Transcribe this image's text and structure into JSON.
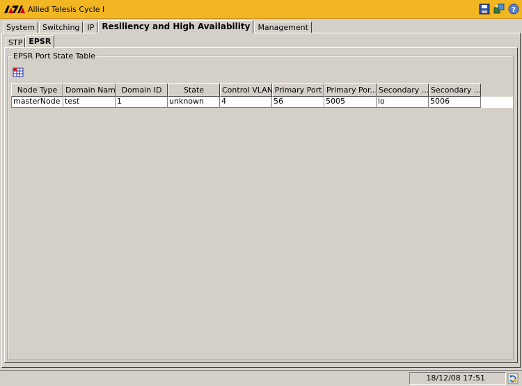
{
  "window": {
    "title": "Allied Telesis Cycle I",
    "logo_icon": "allied-telesis-logo",
    "icons": [
      "save-icon",
      "network-icon",
      "help-icon"
    ]
  },
  "tabs": [
    {
      "label": "System",
      "active": false
    },
    {
      "label": "Switching",
      "active": false
    },
    {
      "label": "IP",
      "active": false
    },
    {
      "label": "Resiliency and High Availability",
      "active": true
    },
    {
      "label": "Management",
      "active": false
    }
  ],
  "subtabs": [
    {
      "label": "STP",
      "active": false
    },
    {
      "label": "EPSR",
      "active": true
    }
  ],
  "panel": {
    "legend": "EPSR Port State Table",
    "table_icon": "table-icon"
  },
  "table": {
    "columns": [
      "Node Type",
      "Domain Name",
      "Domain ID",
      "State",
      "Control VLAN",
      "Primary Port",
      "Primary Por...",
      "Secondary ...",
      "Secondary ..."
    ],
    "rows": [
      [
        "masterNode",
        "test",
        "1",
        "unknown",
        "4",
        "56",
        "5005",
        "lo",
        "5006"
      ]
    ]
  },
  "status": {
    "datetime": "18/12/08 17:51",
    "icon": "refresh-icon"
  },
  "colors": {
    "titlebar": "#f2b622",
    "background": "#d4d0c8"
  }
}
